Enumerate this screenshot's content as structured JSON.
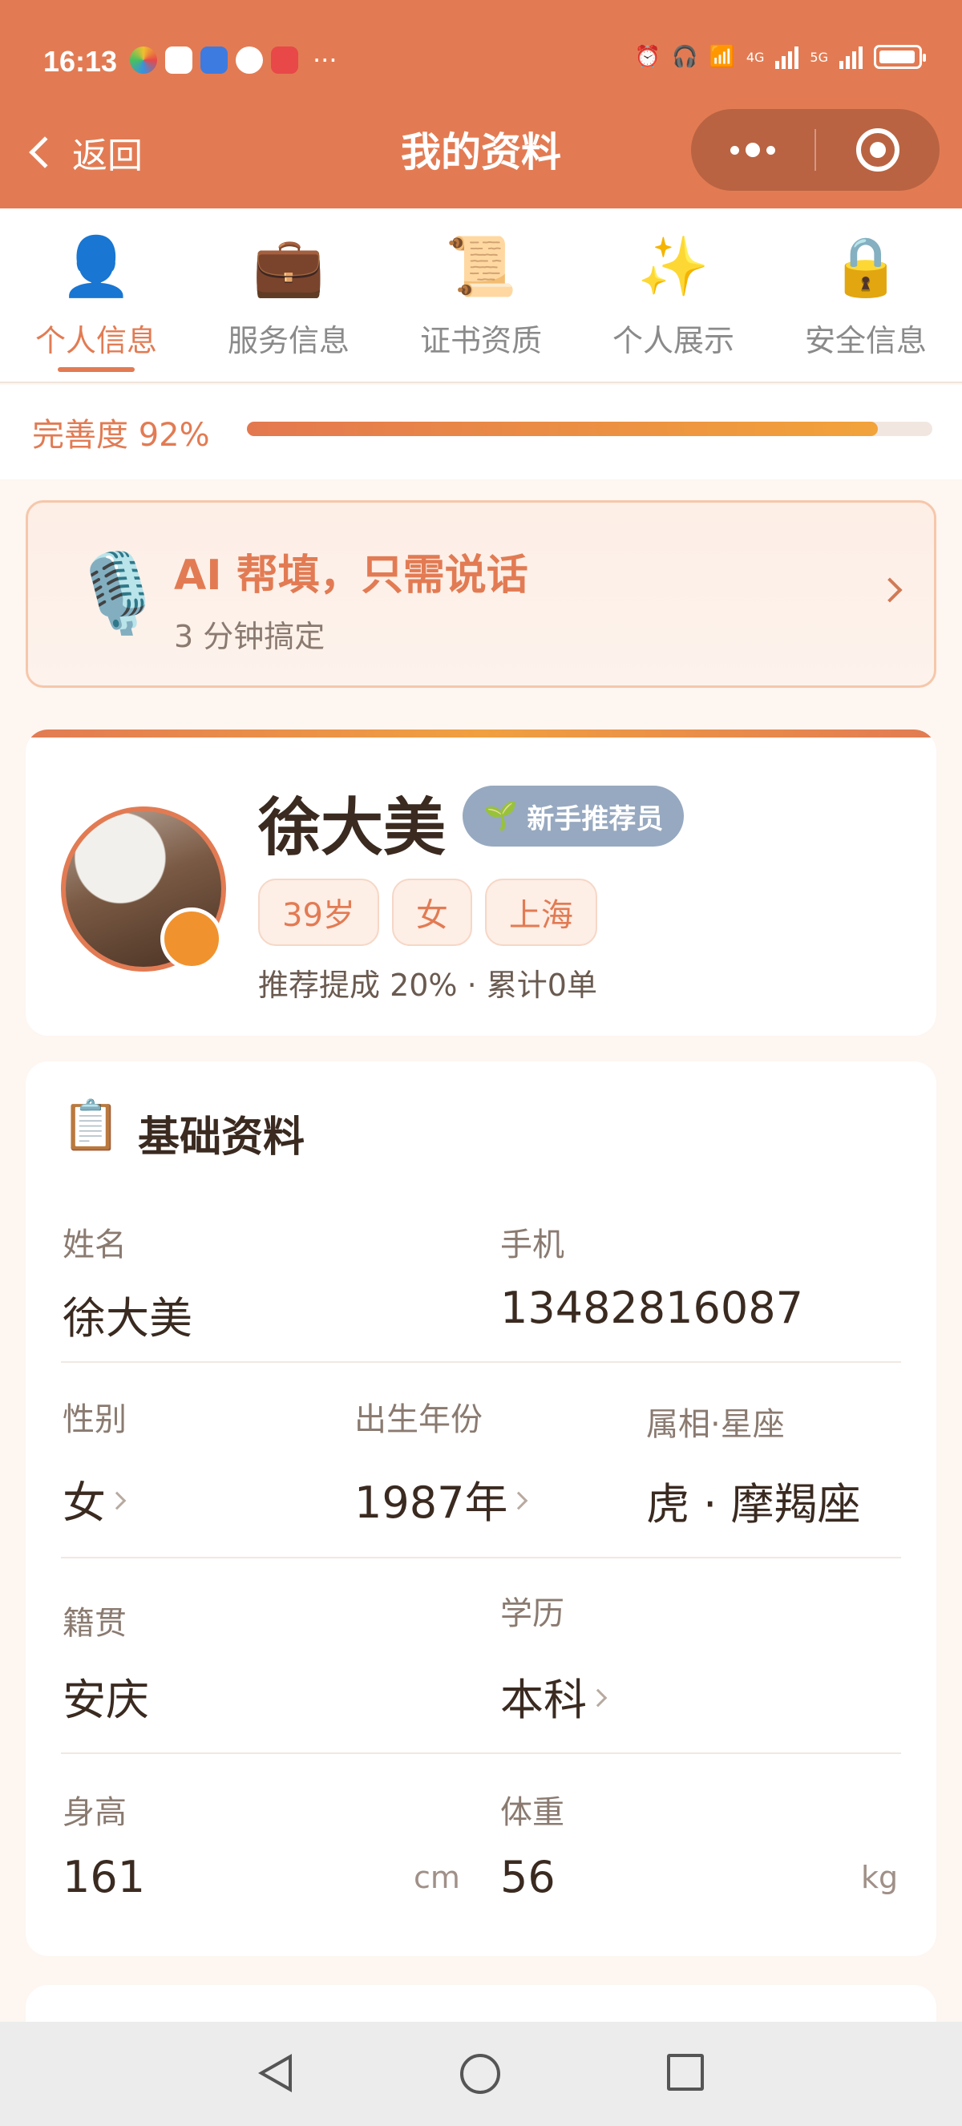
{
  "status_bar": {
    "time": "16:13",
    "more": "···",
    "network_1": "4G",
    "network_2": "5G",
    "icons": [
      "alarm-icon",
      "headphones-icon",
      "wifi-icon",
      "signal-icon",
      "battery-icon"
    ]
  },
  "nav": {
    "back_label": "返回",
    "title": "我的资料"
  },
  "tabs": [
    {
      "icon": "👤",
      "label": "个人信息",
      "active": true
    },
    {
      "icon": "💼",
      "label": "服务信息",
      "active": false
    },
    {
      "icon": "📜",
      "label": "证书资质",
      "active": false
    },
    {
      "icon": "✨",
      "label": "个人展示",
      "active": false
    },
    {
      "icon": "🔒",
      "label": "安全信息",
      "active": false
    }
  ],
  "completion": {
    "label": "完善度 92%",
    "value": 0.92
  },
  "ai_banner": {
    "icon": "🎙️",
    "title": "AI 帮填，只需说话",
    "subtitle": "3 分钟搞定"
  },
  "profile": {
    "name": "徐大美",
    "badge": "新手推荐员",
    "badge_icon": "🌱",
    "chips": [
      "39岁",
      "女",
      "上海"
    ],
    "stats": "推荐提成 20% · 累计0单"
  },
  "basic_info": {
    "icon": "📋",
    "title": "基础资料",
    "name_label": "姓名",
    "name_value": "徐大美",
    "phone_label": "手机",
    "phone_value": "13482816087",
    "gender_label": "性别",
    "gender_value": "女",
    "birth_label": "出生年份",
    "birth_value": "1987年",
    "zodiac_label": "属相·星座",
    "zodiac_value": "虎 · 摩羯座",
    "hometown_label": "籍贯",
    "hometown_value": "安庆",
    "education_label": "学历",
    "education_value": "本科",
    "height_label": "身高",
    "height_value": "161",
    "height_unit": "cm",
    "weight_label": "体重",
    "weight_value": "56",
    "weight_unit": "kg"
  },
  "colors": {
    "accent": "#e27b53",
    "badge": "#97a9c0",
    "progress_end": "#f2a33a"
  }
}
